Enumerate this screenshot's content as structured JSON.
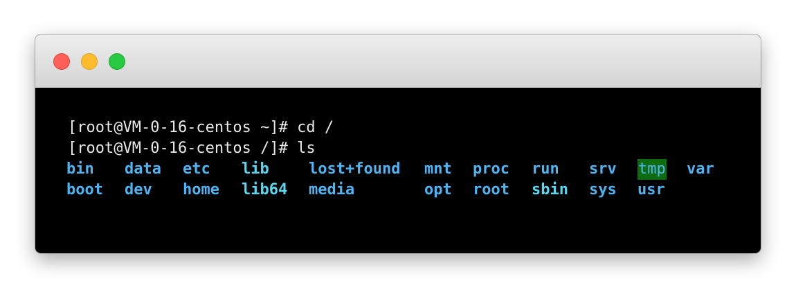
{
  "window": {
    "buttons": [
      "close",
      "minimize",
      "maximize"
    ]
  },
  "terminal": {
    "lines": [
      "[root@VM-0-16-centos ~]# cd /",
      "[root@VM-0-16-centos /]# ls"
    ],
    "ls_output": {
      "row1": [
        "bin",
        "data",
        "etc",
        "lib",
        "lost+found",
        "mnt",
        "proc",
        "run",
        "srv",
        "tmp",
        "var"
      ],
      "row2": [
        "boot",
        "dev",
        "home",
        "lib64",
        "media",
        "opt",
        "root",
        "sbin",
        "sys",
        "usr"
      ]
    },
    "colors": {
      "background": "#000000",
      "text": "#e8e8e8",
      "directory": "#4fb4f2",
      "symlink": "#5ad8f0",
      "sticky_bg": "#0f6b0f"
    }
  }
}
